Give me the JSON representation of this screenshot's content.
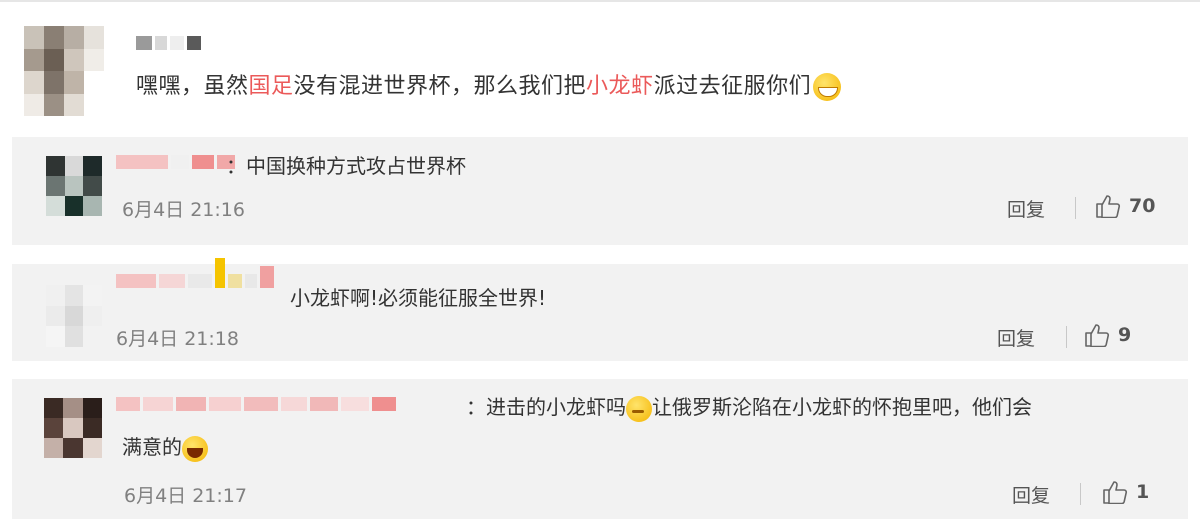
{
  "post": {
    "text_1": "嘿嘿，虽然",
    "highlight_1": "国足",
    "text_2": "没有混进世界杯，那么我们把",
    "highlight_2": "小龙虾",
    "text_3": "派过去征服你们",
    "emoji": "grin-emoji"
  },
  "replies": [
    {
      "text": "：中国换种方式攻占世界杯",
      "time": "6月4日 21:16",
      "reply_label": "回复",
      "likes": "70"
    },
    {
      "text": "小龙虾啊!必须能征服全世界!",
      "time": "6月4日 21:18",
      "reply_label": "回复",
      "likes": "9"
    },
    {
      "text_1": "：进击的小龙虾吗",
      "text_2": "让俄罗斯沦陷在小龙虾的怀抱里吧，他们会",
      "text_3": "满意的",
      "time": "6月4日 21:17",
      "reply_label": "回复",
      "likes": "1"
    }
  ],
  "colors": {
    "highlight": "#eb5a5a",
    "card_bg": "#f2f2f2",
    "muted": "#808080"
  }
}
